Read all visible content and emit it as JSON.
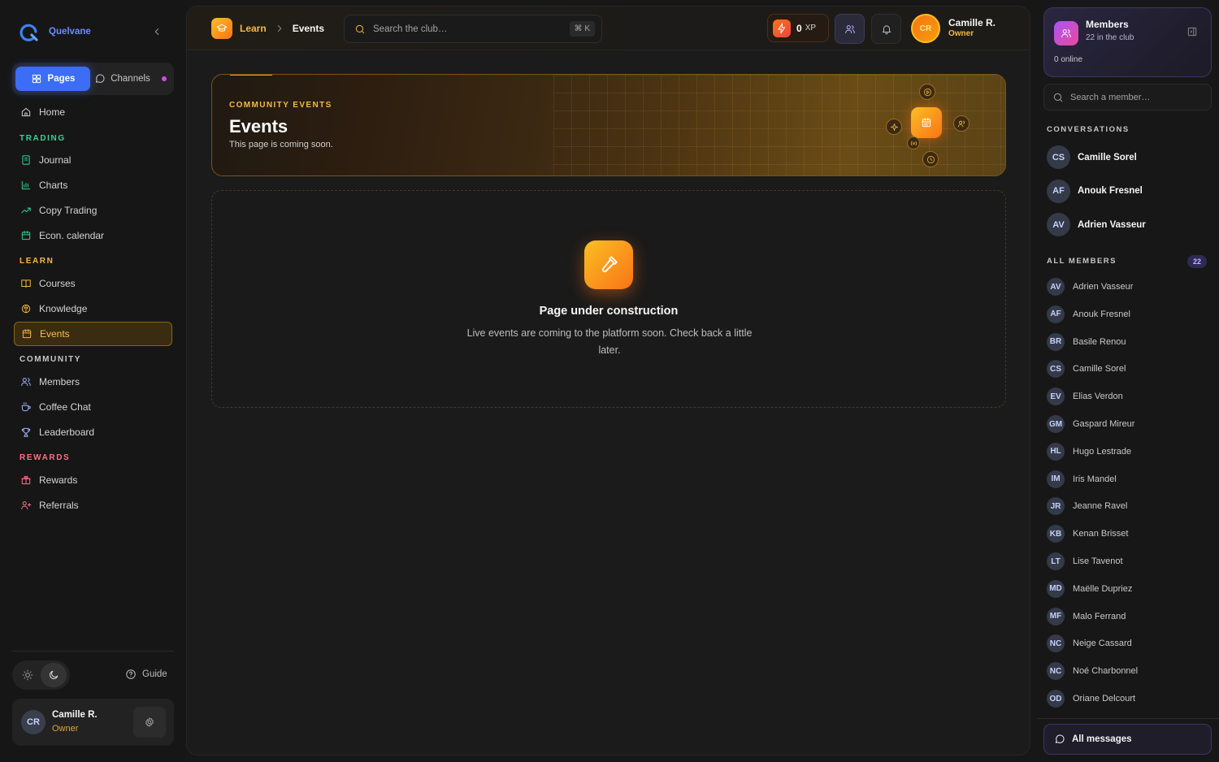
{
  "brand": {
    "name": "Quelvane"
  },
  "sidebar": {
    "tabs": {
      "pages": "Pages",
      "channels": "Channels"
    },
    "home": "Home",
    "sections": {
      "trading": "TRADING",
      "learn": "LEARN",
      "community": "COMMUNITY",
      "rewards": "REWARDS"
    },
    "trading": [
      {
        "label": "Journal",
        "icon": "journal-icon"
      },
      {
        "label": "Charts",
        "icon": "chart-icon"
      },
      {
        "label": "Copy Trading",
        "icon": "trending-up-icon"
      },
      {
        "label": "Econ. calendar",
        "icon": "calendar-icon"
      }
    ],
    "learn": [
      {
        "label": "Courses",
        "icon": "book-icon"
      },
      {
        "label": "Knowledge",
        "icon": "brain-icon"
      },
      {
        "label": "Events",
        "icon": "calendar-icon",
        "active": true
      }
    ],
    "community": [
      {
        "label": "Members",
        "icon": "users-icon"
      },
      {
        "label": "Coffee Chat",
        "icon": "coffee-icon"
      },
      {
        "label": "Leaderboard",
        "icon": "trophy-icon"
      }
    ],
    "rewards": [
      {
        "label": "Rewards",
        "icon": "gift-icon"
      },
      {
        "label": "Referrals",
        "icon": "user-plus-icon"
      }
    ],
    "guide": "Guide",
    "user": {
      "initials": "CR",
      "name": "Camille R.",
      "role": "Owner"
    }
  },
  "topbar": {
    "breadcrumb": {
      "section": "Learn",
      "current": "Events"
    },
    "search": {
      "placeholder": "Search the club…",
      "shortcut": "⌘ K"
    },
    "xp": {
      "value": "0",
      "unit": "XP"
    },
    "user": {
      "initials": "CR",
      "name": "Camille R.",
      "role": "Owner"
    }
  },
  "hero": {
    "kicker": "COMMUNITY EVENTS",
    "title": "Events",
    "subtitle": "This page is coming soon."
  },
  "construction": {
    "title": "Page under construction",
    "description": "Live events are coming to the platform soon. Check back a little later."
  },
  "members_panel": {
    "title": "Members",
    "subtitle": "22 in the club",
    "online": "0 online",
    "search_placeholder": "Search a member…",
    "conversations_label": "CONVERSATIONS",
    "conversations": [
      {
        "initials": "CS",
        "name": "Camille Sorel"
      },
      {
        "initials": "AF",
        "name": "Anouk Fresnel"
      },
      {
        "initials": "AV",
        "name": "Adrien Vasseur"
      }
    ],
    "all_members_label": "ALL MEMBERS",
    "count": "22",
    "members": [
      {
        "initials": "AV",
        "name": "Adrien Vasseur"
      },
      {
        "initials": "AF",
        "name": "Anouk Fresnel"
      },
      {
        "initials": "BR",
        "name": "Basile Renou"
      },
      {
        "initials": "CS",
        "name": "Camille Sorel"
      },
      {
        "initials": "EV",
        "name": "Elias Verdon"
      },
      {
        "initials": "GM",
        "name": "Gaspard Mireur"
      },
      {
        "initials": "HL",
        "name": "Hugo Lestrade"
      },
      {
        "initials": "IM",
        "name": "Iris Mandel"
      },
      {
        "initials": "JR",
        "name": "Jeanne Ravel"
      },
      {
        "initials": "KB",
        "name": "Kenan Brisset"
      },
      {
        "initials": "LT",
        "name": "Lise Tavenot"
      },
      {
        "initials": "MD",
        "name": "Maëlle Dupriez"
      },
      {
        "initials": "MF",
        "name": "Malo Ferrand"
      },
      {
        "initials": "NC",
        "name": "Neige Cassard"
      },
      {
        "initials": "NC",
        "name": "Noé Charbonnel"
      },
      {
        "initials": "OD",
        "name": "Oriane Delcourt"
      }
    ],
    "all_messages": "All messages"
  },
  "colors": {
    "accent": "#f59e0b",
    "primary": "#3b6df6",
    "active_bg": "#3a2c10",
    "purple": "#a855f7"
  }
}
